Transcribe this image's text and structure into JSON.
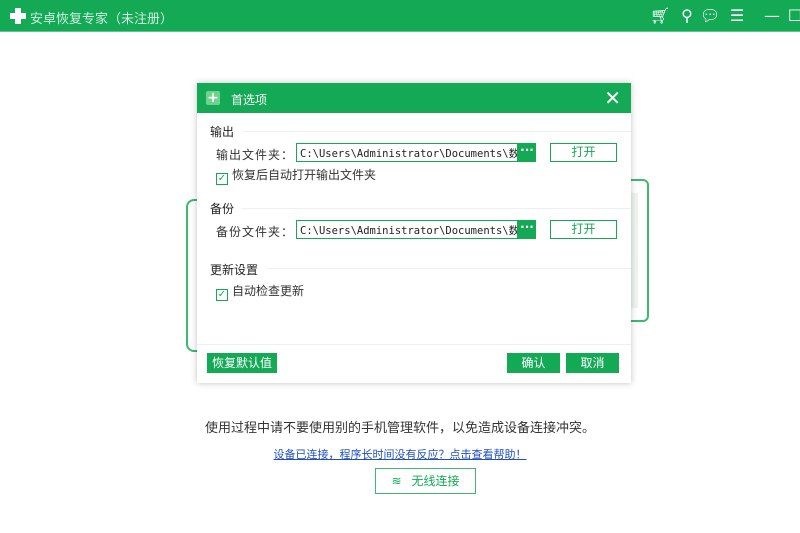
{
  "app": {
    "title": "安卓恢复专家（未注册）"
  },
  "dialog": {
    "title": "首选项",
    "output": {
      "section": "输出",
      "label": "输出文件夹：",
      "path": "C:\\Users\\Administrator\\Documents\\数",
      "browse": "···",
      "open": "打开",
      "auto_open_label": "恢复后自动打开输出文件夹",
      "auto_open_checked": true
    },
    "backup": {
      "section": "备份",
      "label": "备份文件夹：",
      "path": "C:\\Users\\Administrator\\Documents\\数",
      "browse": "···",
      "open": "打开"
    },
    "update": {
      "section": "更新设置",
      "auto_check_label": "自动检查更新",
      "auto_check_checked": true
    },
    "restore_defaults": "恢复默认值",
    "confirm": "确认",
    "cancel": "取消"
  },
  "main": {
    "warning": "使用过程中请不要使用别的手机管理软件，以免造成设备连接冲突。",
    "help_link": "设备已连接，程序长时间没有反应？点击查看帮助！",
    "wireless_button": "无线连接"
  },
  "colors": {
    "brand": "#13a955",
    "link": "#1f4fbf"
  }
}
